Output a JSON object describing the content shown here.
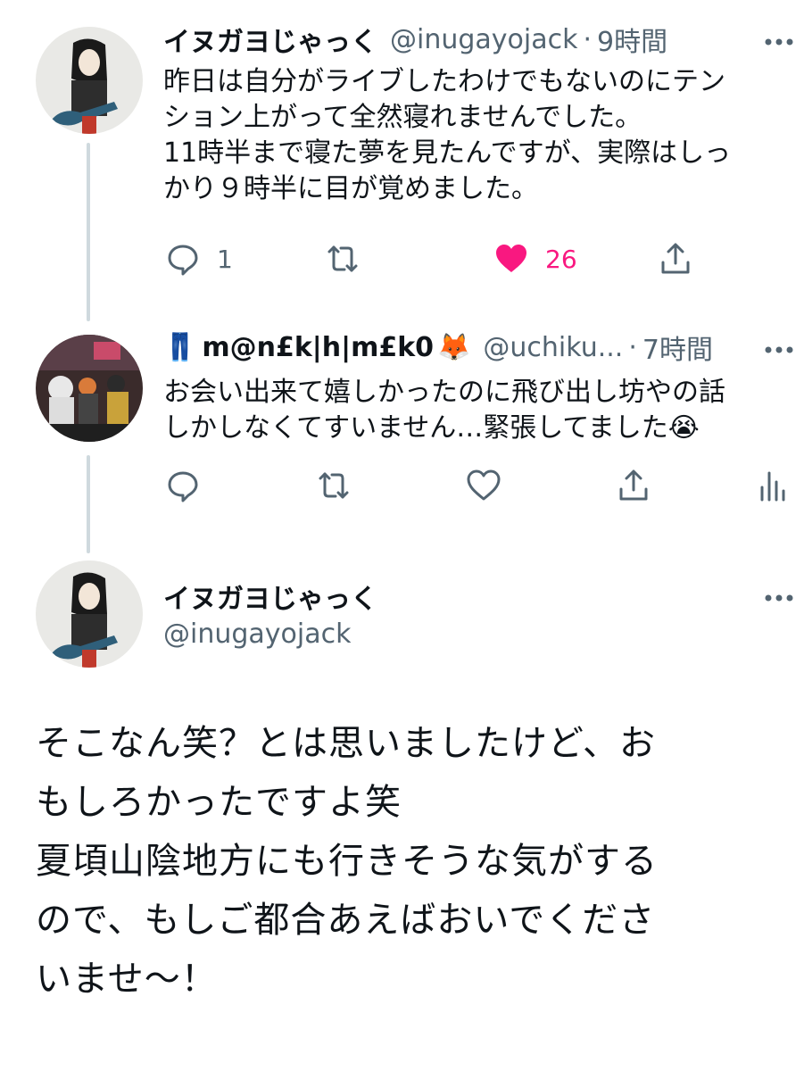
{
  "tweets": [
    {
      "name": "イヌガヨじゃっく",
      "handle": "@inugayojack",
      "separator": "·",
      "time": "9時間",
      "lines": [
        "昨日は自分がライブしたわけでもないのにテン",
        "ション上がって全然寝れませんでした。",
        "11時半まで寝た夢を見たんですが、実際はしっ",
        "かり９時半に目が覚めました。"
      ],
      "reply_count": "1",
      "like_count": "26",
      "liked": true
    },
    {
      "name_prefix_emoji": "👖",
      "name": "m@n£k|h|m£k0",
      "name_suffix_emoji": "🦊",
      "handle": "@uchiku...",
      "separator": "·",
      "time": "7時間",
      "lines": [
        "お会い出来て嬉しかったのに飛び出し坊やの話",
        "しかしなくてすいません…緊張してました😭"
      ]
    },
    {
      "name": "イヌガヨじゃっく",
      "handle": "@inugayojack",
      "lines": [
        "そこなん笑？とは思いましたけど、お",
        "もしろかったですよ笑",
        "夏頃山陰地方にも行きそうな気がする",
        "ので、もしご都合あえばおいでくださ",
        "いませ〜！"
      ]
    }
  ],
  "icons": {
    "reply": "reply-icon",
    "retweet": "retweet-icon",
    "like": "heart-icon",
    "share": "share-icon",
    "analytics": "analytics-icon",
    "more": "more-icon"
  },
  "colors": {
    "like": "#f91880",
    "secondary_text": "#536471",
    "thread_line": "#cfd9de"
  }
}
